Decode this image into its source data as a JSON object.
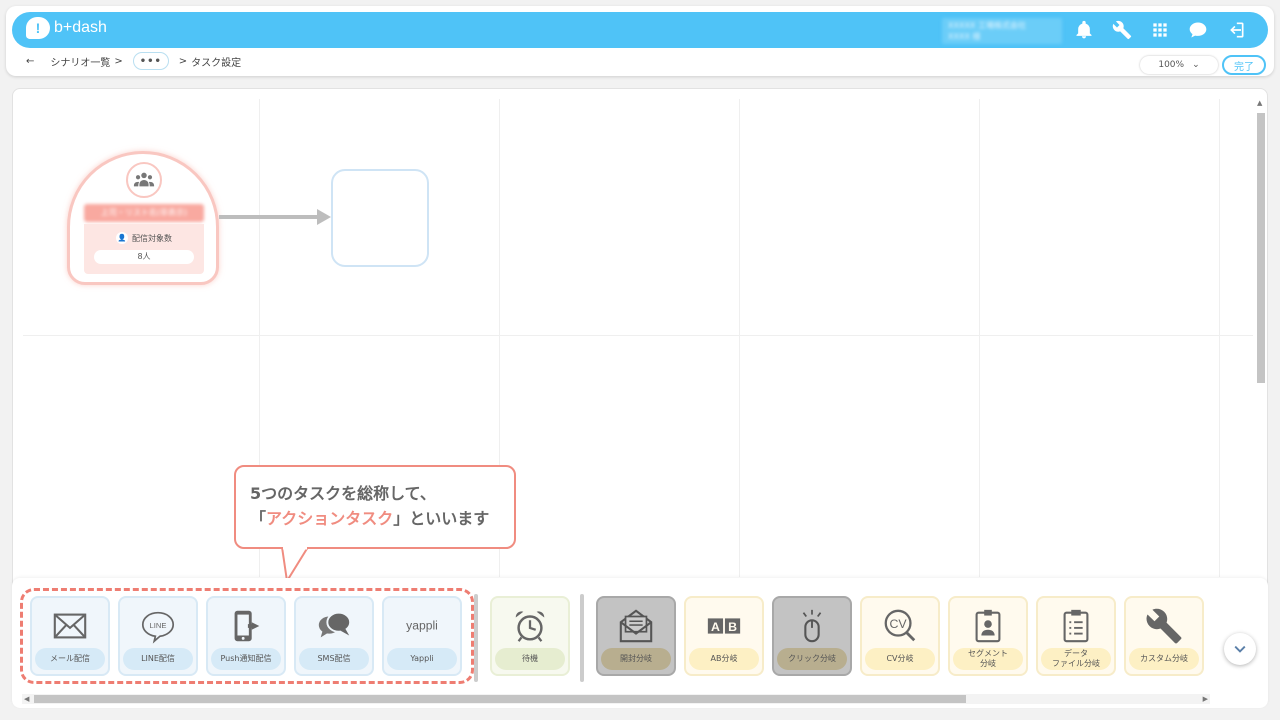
{
  "header": {
    "logo_text": "b+dash",
    "logo_mark": "!",
    "user_line1": "XXXXX 工場株式会社",
    "user_line2": "XXXX 様",
    "icons": [
      "bell-icon",
      "wrench-icon",
      "grid-icon",
      "chat-icon",
      "logout-icon"
    ]
  },
  "breadcrumb": {
    "back": "←",
    "scenario_list": "シナリオ一覧",
    "sep1": ">",
    "more": "•••",
    "sep2": ">",
    "current": "タスク設定"
  },
  "zoom": {
    "value": "100%",
    "arrow": "⌄"
  },
  "done_label": "完了",
  "start_node": {
    "name": "上司・リスト名(非表示)",
    "target_label": "配信対象数",
    "count": "8人"
  },
  "callout": {
    "line1": "5つのタスクを総称して、",
    "line2_open": "「",
    "line2_highlight": "アクションタスク",
    "line2_close": "」といいます"
  },
  "palette": {
    "action_tasks": [
      {
        "label": "メール配信",
        "icon": "envelope-icon"
      },
      {
        "label": "LINE配信",
        "icon": "line-icon",
        "icon_text": "LINE"
      },
      {
        "label": "Push通知配信",
        "icon": "push-icon"
      },
      {
        "label": "SMS配信",
        "icon": "chat-bubbles-icon"
      },
      {
        "label": "Yappli",
        "icon": "yappli-icon",
        "icon_text": "yappli"
      }
    ],
    "wait_task": {
      "label": "待機",
      "icon": "alarm-clock-icon"
    },
    "branch_tasks": [
      {
        "label": "開封分岐",
        "icon": "open-mail-icon"
      },
      {
        "label": "AB分岐",
        "icon": "ab-icon",
        "icon_text": "AB"
      },
      {
        "label": "クリック分岐",
        "icon": "mouse-icon"
      },
      {
        "label": "CV分岐",
        "icon": "cv-icon",
        "icon_text": "CV"
      },
      {
        "label": "セグメント\n分岐",
        "icon": "id-badge-icon"
      },
      {
        "label": "データ\nファイル分岐",
        "icon": "clipboard-icon"
      },
      {
        "label": "カスタム分岐",
        "icon": "wrench-icon"
      }
    ]
  },
  "colors": {
    "accent": "#4fc3f7",
    "callout": "#f08c80",
    "start_node": "#f9c7c1"
  }
}
